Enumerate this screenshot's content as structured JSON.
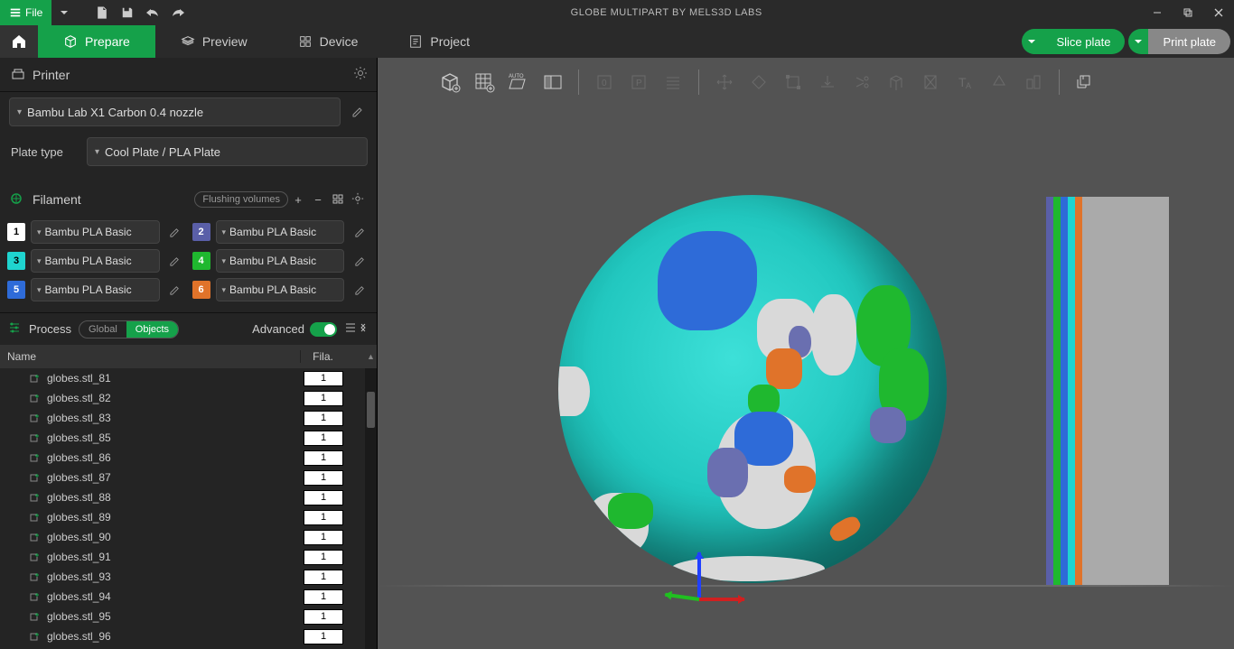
{
  "titlebar": {
    "file": "File",
    "title": "GLOBE MULTIPART BY MELS3D LABS"
  },
  "tabs": {
    "prepare": "Prepare",
    "preview": "Preview",
    "device": "Device",
    "project": "Project"
  },
  "actions": {
    "slice": "Slice plate",
    "print": "Print plate"
  },
  "printer": {
    "section": "Printer",
    "model": "Bambu Lab X1 Carbon 0.4 nozzle",
    "plate_label": "Plate type",
    "plate": "Cool Plate / PLA Plate"
  },
  "filament": {
    "section": "Filament",
    "flush": "Flushing volumes",
    "items": [
      {
        "num": "1",
        "color": "#ffffff",
        "fg": "#000",
        "name": "Bambu PLA Basic"
      },
      {
        "num": "2",
        "color": "#5a5fa8",
        "fg": "#fff",
        "name": "Bambu PLA Basic"
      },
      {
        "num": "3",
        "color": "#1fd4cf",
        "fg": "#000",
        "name": "Bambu PLA Basic"
      },
      {
        "num": "4",
        "color": "#1fb82f",
        "fg": "#fff",
        "name": "Bambu PLA Basic"
      },
      {
        "num": "5",
        "color": "#2e6bd8",
        "fg": "#fff",
        "name": "Bambu PLA Basic"
      },
      {
        "num": "6",
        "color": "#e0732a",
        "fg": "#fff",
        "name": "Bambu PLA Basic"
      }
    ]
  },
  "process": {
    "section": "Process",
    "global": "Global",
    "objects": "Objects",
    "advanced": "Advanced"
  },
  "list": {
    "name_hdr": "Name",
    "fila_hdr": "Fila.",
    "rows": [
      {
        "name": "globes.stl_81",
        "fila": "1"
      },
      {
        "name": "globes.stl_82",
        "fila": "1"
      },
      {
        "name": "globes.stl_83",
        "fila": "1"
      },
      {
        "name": "globes.stl_85",
        "fila": "1"
      },
      {
        "name": "globes.stl_86",
        "fila": "1"
      },
      {
        "name": "globes.stl_87",
        "fila": "1"
      },
      {
        "name": "globes.stl_88",
        "fila": "1"
      },
      {
        "name": "globes.stl_89",
        "fila": "1"
      },
      {
        "name": "globes.stl_90",
        "fila": "1"
      },
      {
        "name": "globes.stl_91",
        "fila": "1"
      },
      {
        "name": "globes.stl_93",
        "fila": "1"
      },
      {
        "name": "globes.stl_94",
        "fila": "1"
      },
      {
        "name": "globes.stl_95",
        "fila": "1"
      },
      {
        "name": "globes.stl_96",
        "fila": "1"
      }
    ]
  },
  "stripes": [
    "#e0732a",
    "#1fd4cf",
    "#2e6bd8",
    "#1fb82f",
    "#5a5fa8"
  ]
}
